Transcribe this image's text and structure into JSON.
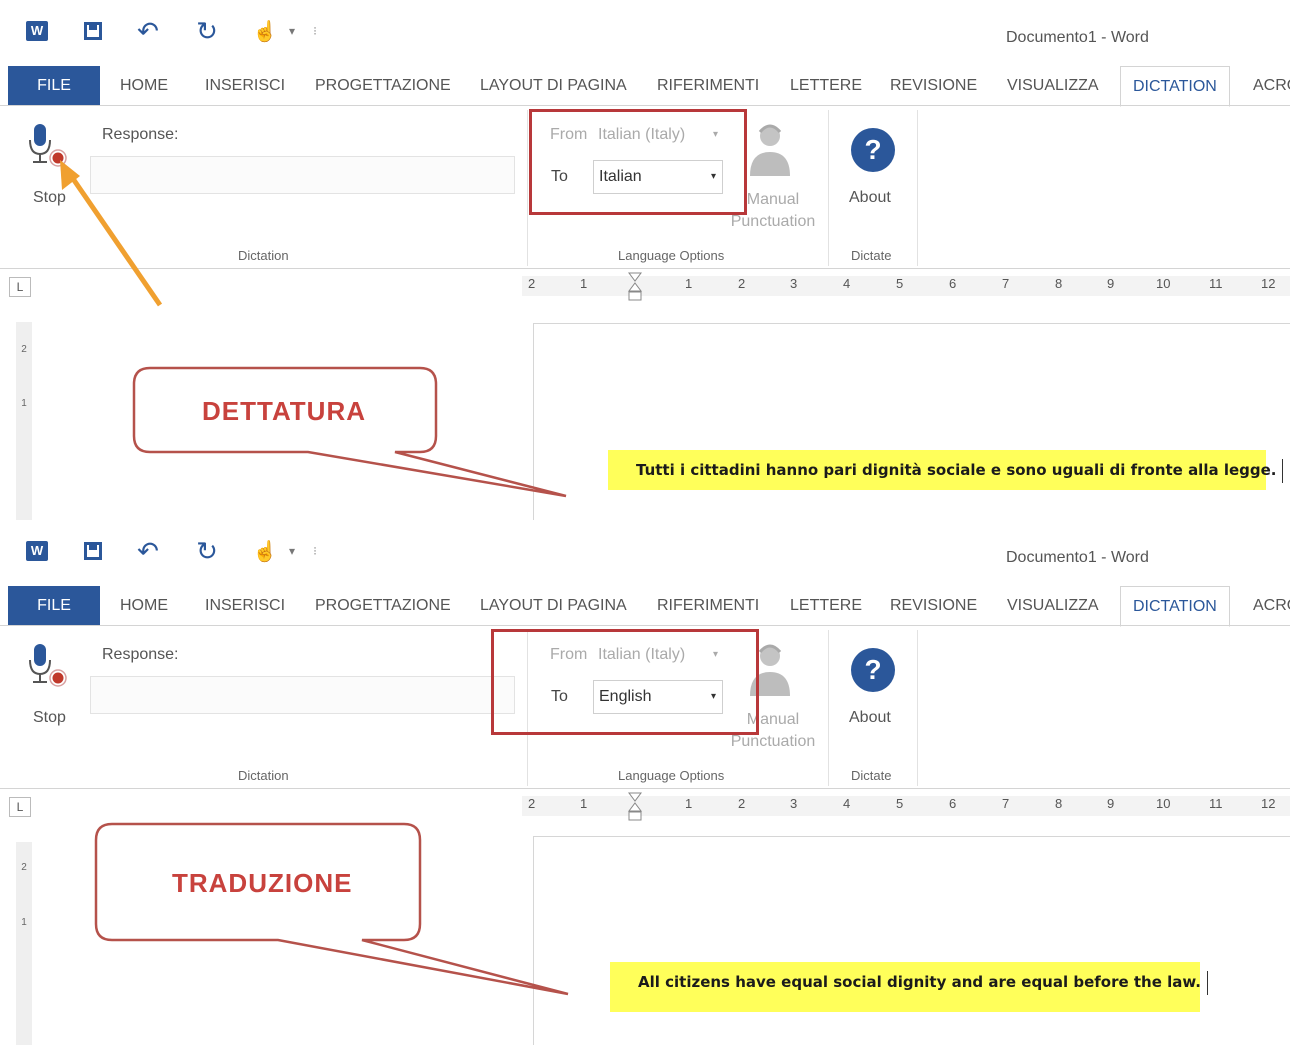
{
  "window": {
    "title": "Documento1 - Word",
    "app_icon": "W"
  },
  "ribbon_tabs": [
    "FILE",
    "HOME",
    "INSERISCI",
    "PROGETTAZIONE",
    "LAYOUT DI PAGINA",
    "RIFERIMENTI",
    "LETTERE",
    "REVISIONE",
    "VISUALIZZA",
    "DICTATION",
    "ACRO"
  ],
  "dictation_group": {
    "stop_label": "Stop",
    "response_label": "Response:",
    "response_value": "",
    "group_label": "Dictation"
  },
  "language_group": {
    "from_label": "From",
    "from_value": "Italian (Italy)",
    "to_label": "To",
    "group_label": "Language Options",
    "manual_label": "Manual Punctuation"
  },
  "dictate_group": {
    "about_label": "About",
    "group_label": "Dictate"
  },
  "ruler": {
    "marks": [
      "2",
      "1",
      "1",
      "2",
      "3",
      "4",
      "5",
      "6",
      "7",
      "8",
      "9",
      "10",
      "11",
      "12"
    ],
    "tab_symbol": "L"
  },
  "vertical_ruler": [
    "2",
    "1"
  ],
  "panels": [
    {
      "to_value": "Italian",
      "callout": "DETTATURA",
      "document_text": "Tutti i cittadini hanno pari dignità sociale e sono uguali di fronte alla legge."
    },
    {
      "to_value": "English",
      "callout": "TRADUZIONE",
      "document_text": "All citizens have equal social dignity and are equal before the law."
    }
  ],
  "colors": {
    "accent": "#2b579a",
    "highlight_box": "#b8383a",
    "arrow": "#f0a030",
    "callout_text": "#c8423d",
    "text_highlight": "#ffff5a"
  },
  "icons": [
    "word-logo-icon",
    "save-icon",
    "undo-icon",
    "redo-icon",
    "touch-mode-icon",
    "microphone-icon",
    "record-icon",
    "person-icon",
    "help-icon"
  ]
}
